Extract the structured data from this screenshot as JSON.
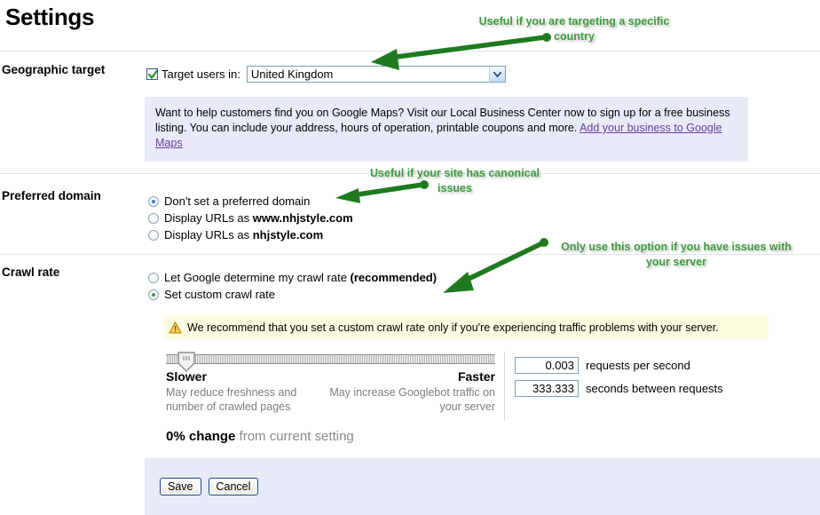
{
  "page": {
    "title": "Settings"
  },
  "sections": {
    "geographic": {
      "label": "Geographic target",
      "checkbox_label": "Target users in:",
      "checkbox_checked": true,
      "select_value": "United Kingdom",
      "info_text_1": "Want to help customers find you on Google Maps? Visit our Local Business Center now to sign up for a free business listing. You can include your address, hours of operation, printable coupons and more. ",
      "info_link": "Add your business to Google Maps"
    },
    "preferred_domain": {
      "label": "Preferred domain",
      "options": [
        {
          "label": "Don't set a preferred domain",
          "bold": "",
          "selected": true
        },
        {
          "label": "Display URLs as ",
          "bold": "www.nhjstyle.com",
          "selected": false
        },
        {
          "label": "Display URLs as ",
          "bold": "nhjstyle.com",
          "selected": false
        }
      ]
    },
    "crawl_rate": {
      "label": "Crawl rate",
      "options": [
        {
          "label": "Let Google determine my crawl rate ",
          "bold": "(recommended)",
          "selected": false
        },
        {
          "label": "Set custom crawl rate",
          "bold": "",
          "selected": true
        }
      ],
      "warning_text": "We recommend that you set a custom crawl rate only if you're experiencing traffic problems with your server.",
      "slider": {
        "position_percent": 4,
        "slower_title": "Slower",
        "slower_sub": "May reduce freshness and number of crawled pages",
        "faster_title": "Faster",
        "faster_sub": "May increase Googlebot traffic on your server"
      },
      "fields": [
        {
          "value": "0.003",
          "label": "requests per second"
        },
        {
          "value": "333.333",
          "label": "seconds between requests"
        }
      ],
      "change_pct": "0% change",
      "change_rest": " from current setting"
    }
  },
  "footer": {
    "save_label": "Save",
    "cancel_label": "Cancel"
  },
  "annotations": [
    {
      "text": "Useful if you are targeting a specific country"
    },
    {
      "text": "Useful if your site has canonical issues"
    },
    {
      "text": "Only use this option if you have issues with your server"
    }
  ],
  "colors": {
    "annotation_green": "#3f9b3f",
    "arrow_green": "#1f7a1f",
    "info_box_bg": "#e7ebf8",
    "warning_bg": "#fdfbdf",
    "link_purple": "#6a3ca0"
  }
}
